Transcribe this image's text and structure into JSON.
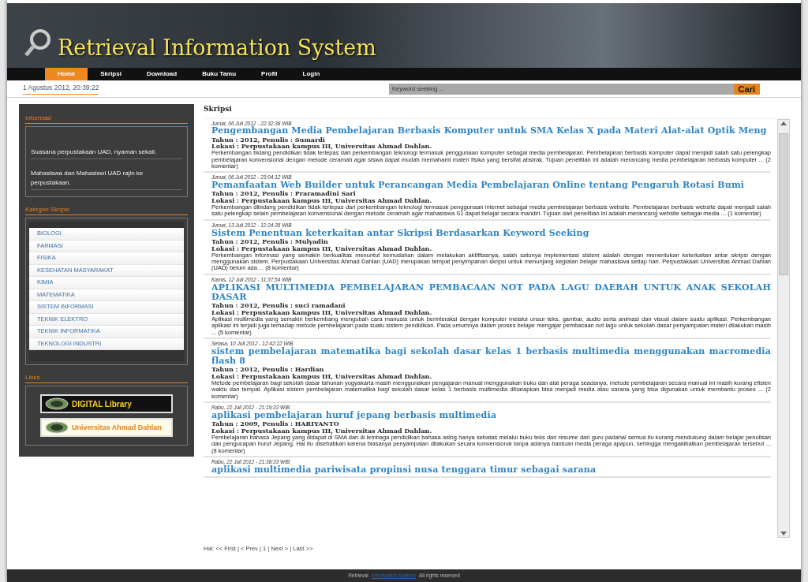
{
  "header": {
    "title": "Retrieval Information System"
  },
  "nav": [
    {
      "label": "Home",
      "selected": true
    },
    {
      "label": "Skripsi",
      "selected": false
    },
    {
      "label": "Download",
      "selected": false
    },
    {
      "label": "Buku Tamu",
      "selected": false
    },
    {
      "label": "Profil",
      "selected": false
    },
    {
      "label": "Login",
      "selected": false
    }
  ],
  "datetime": "1 Agustus 2012, 20:39:22",
  "search": {
    "placeholder": "Keyword seeking ...",
    "button": "Cari"
  },
  "sidebar": {
    "sections": [
      {
        "kind": "info",
        "title": "Informasi",
        "items": [
          "Suasana perpustakaan UAD, nyaman sekali.",
          "Mahasiswa dan Mahasiswi UAD rajin ke perpustakaan."
        ]
      },
      {
        "kind": "list",
        "title": "Kategori Skripsi",
        "items": [
          "BIOLOGI",
          "FARMASI",
          "FISIKA",
          "KESEHATAN MASYARAKAT",
          "KIMIA",
          "MATEMATIKA",
          "SISTEM INFORMASI",
          "TEKNIK ELEKTRO",
          "TEKNIK INFORMATIKA",
          "TEKNOLOGI INDUSTRI"
        ]
      },
      {
        "kind": "links",
        "title": "Links",
        "items": [
          {
            "kind": "dark",
            "label": "DIGITAL Library"
          },
          {
            "kind": "light",
            "label": "Universitas Ahmad Dahlan"
          }
        ]
      }
    ]
  },
  "content": {
    "heading": "Skripsi",
    "entries": [
      {
        "date": "Jumat, 06 Juli 2012 - 22:32:38 WIB",
        "title": "Pengembangan Media Pembelajaran Berbasis Komputer untuk SMA Kelas X pada Materi Alat-alat Optik Meng",
        "meta": "Tahun : 2012, Penulis : Sumardi",
        "location": "Lokasi : Perpustakaan kampus III, Universitas Ahmad Dahlan.",
        "abstract": "Perkembangan bidang pendidikan tidak terlepas dari perkembangan teknologi termasuk penggunaan komputer sebagai media pembelajaran. Pembelajaran berbasis komputer dapat menjadi salah satu pelengkap pembelajaran konvensional dengan metode ceramah agar siswa dapat mudah memahami materi fisika yang bersifat abstrak. Tujuan penelitian ini adalah merancang media pembelajaran berbasis komputer ... (2 komentar)"
      },
      {
        "date": "Jumat, 06 Juli 2012 - 23:04:12 WIB",
        "title": "Pemanfaatan Web Builder untuk Perancangan Media Pembelajaran Online tentang Pengaruh Rotasi Bumi",
        "meta": "Tahun : 2012, Penulis : Praramadini Sari",
        "location": "Lokasi : Perpustakaan kampus III, Universitas Ahmad Dahlan.",
        "abstract": "Perkembangan dibidang pendidikan tidak terlepas dari perkembangan teknologi termasuk penggunaan internet sebagai media pembelajaran berbasis website. Pembelajaran berbasis website dapat menjadi salah satu pelengkap selain pembelajaran konvensional dengan metode ceramah agar mahasiswa S1 dapat belajar secara mandiri. Tujuan dari penelitian ini adalah merancang website sebagai media ... (1 komentar)"
      },
      {
        "date": "Jumat, 13 Juli 2012 - 12:24:35 WIB",
        "title": "Sistem Penentuan keterkaitan antar Skripsi Berdasarkan Keyword Seeking",
        "meta": "Tahun : 2012, Penulis : Mulyadin",
        "location": "Lokasi : Perpustakaan kampus III, Universitas Ahmad Dahlan.",
        "abstract": "Perkembangan informasi yang semakin berkualitas menuntut kemudahan dalam melakukan aktifitasnya, salah satunya implementasi sistem adalah dengan menentukan keterkaitan antar skripsi dengan menggunakan sistem. Perpustakaan Universitas Ahmad Dahlan (UAD) merupakan tempat penyimpanan skripsi untuk menunjang kegiatan belajar mahasiswa setiap hari. Perpustakaan Universitas Ahmad Dahlan (UAD) belum ada ... (8 komentar)"
      },
      {
        "date": "Kamis, 12 Juli 2012 - 11:37:54 WIB",
        "title": "APLIKASI MULTIMEDIA PEMBELAJARAN PEMBACAAN NOT PADA LAGU DAERAH UNTUK ANAK SEKOLAH DASAR",
        "meta": "Tahun : 2012, Penulis : suci ramadani",
        "location": "Lokasi : Perpustakaan kampus III, Universitas Ahmad Dahlan.",
        "abstract": "Aplikasi multimedia yang semakin berkembang mengubah cara manusia untuk berinteraksi dengan komputer melalui unsur teks, gambar, audio serta animasi dan visual dalam suatu aplikasi. Perkembangan aplikasi ini terjadi juga terhadap metode pembelajaran pada suatu sistem pendidikan. Pada umumnya dalam proses belajar mengajar pembacaan not lagu untuk sekolah dasar penyampaian materi dilakukan masih ... (5 komentar)"
      },
      {
        "date": "Selasa, 10 Juli 2012 - 12:42:22 WIB",
        "title": "sistem pembelajaran matematika bagi sekolah dasar kelas 1 berbasis multimedia menggunakan macromedia flash 8",
        "meta": "Tahun : 2012, Penulis : Hardian",
        "location": "Lokasi : Perpustakaan kampus III, Universitas Ahmad Dahlan.",
        "abstract": "Metode pembelajaran bagi sekolah dasar tahunan yogyakarta masih menggunakan pengajaran manual menggunakan buku dan alat peraga seadanya, metode pembelajaran secara manual ini masih kurang efisien waktu dan tempat. Aplikasi sistem pembelajaran matematika bagi sekolah dasar kelas 1 berbasis multimedia diharapkan bisa menjadi media atau sarana yang bisa digunakan untuk membantu proses ... (2 komentar)"
      },
      {
        "date": "Rabu, 22 Juli 2012 - 21:19:33 WIB",
        "title": "aplikasi pembelajaran huruf jepang berbasis multimedia",
        "meta": "Tahun : 2009, Penulis : HARIYANTO",
        "location": "Lokasi : Perpustakaan kampus III, Universitas Ahmad Dahlan.",
        "abstract": "Pembelajaran bahasa Jepang yang didapat di SMA dan di lembaga pendidikan bahasa asing hanya sebatas melalui buku teks dan resume dari guru padahal semua itu kurang mendukung dalam belajar penulisan dan pengucapan huruf Jepang. Hal itu disebabkan karena biasanya penyampaian dilakukan secara konvensional tanpa adanya bantuan media peraga apapun, sehingga mengakibatkan pembelajaran tersebut ... (8 komentar)"
      },
      {
        "date": "Rabu, 22 Juli 2012 - 21:38:33 WIB",
        "title": "aplikasi multimedia pariwisata propinsi nusa tenggara timur sebagai sarana"
      }
    ],
    "pagination": "Hal: << First | < Prev | 1 | Next > | Last >>"
  },
  "footer": {
    "text": "Retrieval",
    "link": "Information System",
    "rights": "All rights reserved"
  }
}
